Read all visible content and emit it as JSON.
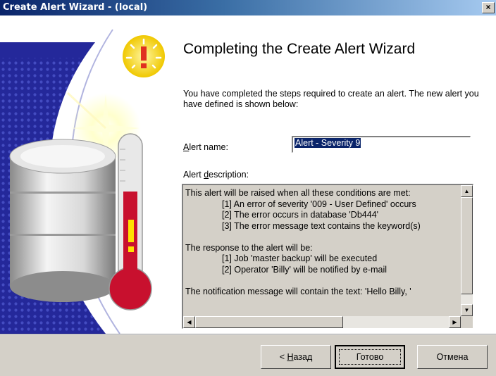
{
  "window": {
    "title": "Create Alert Wizard - (local)",
    "close_glyph": "×"
  },
  "page": {
    "heading": "Completing the Create Alert Wizard",
    "intro": "You have completed the steps required to create an alert.  The new alert you have defined is shown below:"
  },
  "alert_name": {
    "label_accesskey": "A",
    "label_rest": "lert name:",
    "value": "Alert - Severity 9"
  },
  "alert_description": {
    "label_start": "Alert ",
    "label_accesskey": "d",
    "label_rest": "escription:",
    "lines": [
      "This alert will be raised when all these conditions are met:",
      "[1] An error of severity '009 - User Defined' occurs",
      "[2] The error occurs in database 'Db444'",
      "[3] The error message text contains the keyword(s)",
      "",
      "The response to the alert will be:",
      "[1] Job 'master backup' will be executed",
      "[2] Operator 'Billy' will be notified by e-mail",
      "",
      "The notification message will contain the text: 'Hello Billy, '"
    ]
  },
  "buttons": {
    "back_prefix": "< ",
    "back_accesskey": "Н",
    "back_rest": "азад",
    "finish": "Готово",
    "cancel": "Отмена"
  },
  "icons": [
    "close-icon",
    "warning-sun-icon",
    "database-icon",
    "thermometer-icon",
    "scroll-up-icon",
    "scroll-down-icon",
    "scroll-left-icon",
    "scroll-right-icon"
  ],
  "colors": {
    "titlebar_start": "#0a246a",
    "titlebar_end": "#a6caf0",
    "art_blue": "#2b2f9e",
    "selection": "#0a246a"
  }
}
